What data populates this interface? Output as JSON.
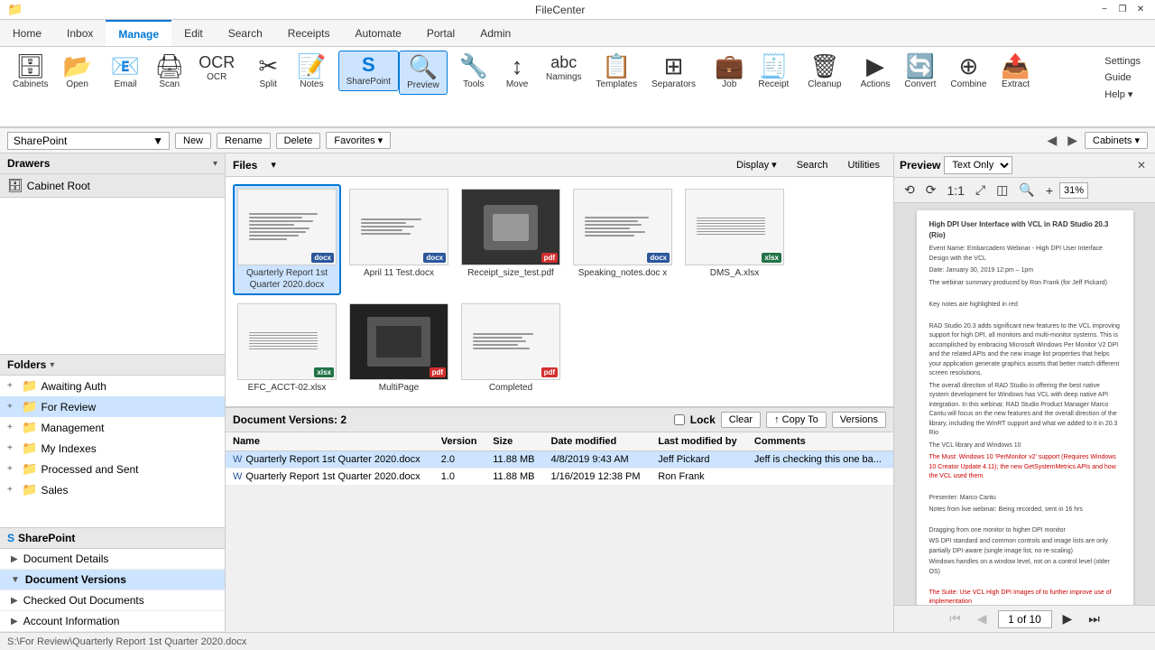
{
  "titlebar": {
    "title": "FileCenter",
    "minimize": "−",
    "restore": "❐",
    "close": "✕",
    "icon": "📁"
  },
  "ribbonTabs": [
    {
      "label": "Home",
      "active": false
    },
    {
      "label": "Inbox",
      "active": false
    },
    {
      "label": "Manage",
      "active": true
    },
    {
      "label": "Edit",
      "active": false
    },
    {
      "label": "Search",
      "active": false
    },
    {
      "label": "Receipts",
      "active": false
    },
    {
      "label": "Automate",
      "active": false
    },
    {
      "label": "Portal",
      "active": false
    },
    {
      "label": "Admin",
      "active": false
    }
  ],
  "ribbon": {
    "buttons": [
      {
        "id": "cabinets",
        "icon": "🗄",
        "label": "Cabinets"
      },
      {
        "id": "open",
        "icon": "📂",
        "label": "Open"
      },
      {
        "id": "email",
        "icon": "📧",
        "label": "Email"
      },
      {
        "id": "scan",
        "icon": "🖨",
        "label": "Scan"
      },
      {
        "id": "ocr",
        "icon": "📄",
        "label": "OCR"
      },
      {
        "id": "split",
        "icon": "✂",
        "label": "Split"
      },
      {
        "id": "notes",
        "icon": "📝",
        "label": "Notes"
      },
      {
        "id": "sharepoint",
        "icon": "S",
        "label": "SharePoint",
        "active": true
      },
      {
        "id": "preview",
        "icon": "🔍",
        "label": "Preview",
        "active": true
      },
      {
        "id": "tools",
        "icon": "🔧",
        "label": "Tools"
      },
      {
        "id": "move",
        "icon": "↕",
        "label": "Move"
      },
      {
        "id": "namings",
        "icon": "🏷",
        "label": "Namings"
      },
      {
        "id": "templates",
        "icon": "📋",
        "label": "Templates"
      },
      {
        "id": "separators",
        "icon": "⊞",
        "label": "Separators"
      },
      {
        "id": "job",
        "icon": "💼",
        "label": "Job"
      },
      {
        "id": "receipt",
        "icon": "🧾",
        "label": "Receipt"
      },
      {
        "id": "cleanup",
        "icon": "🗑",
        "label": "Cleanup"
      },
      {
        "id": "actions",
        "icon": "▶",
        "label": "Actions"
      },
      {
        "id": "convert",
        "icon": "🔄",
        "label": "Convert"
      },
      {
        "id": "combine",
        "icon": "⊕",
        "label": "Combine"
      },
      {
        "id": "extract",
        "icon": "📤",
        "label": "Extract"
      }
    ],
    "sideButtons": [
      {
        "label": "Settings"
      },
      {
        "label": "Guide"
      },
      {
        "label": "Help ▾"
      }
    ]
  },
  "addressBar": {
    "current": "SharePoint",
    "actions": [
      "New",
      "Rename",
      "Delete",
      "Favorites ▾"
    ],
    "navPrev": "◀",
    "navNext": "▶",
    "comboArrow": "▼",
    "cabinetsBtn": "Cabinets ▾"
  },
  "leftPanel": {
    "drawersLabel": "Drawers",
    "drawersExpand": "▾",
    "drawerInput": "",
    "cabinetRoot": "Cabinet Root",
    "foldersLabel": "Folders",
    "foldersExpand": "▾",
    "folders": [
      {
        "name": "Awaiting Auth",
        "expanded": false,
        "level": 1
      },
      {
        "name": "For Review",
        "expanded": false,
        "level": 1,
        "selected": true
      },
      {
        "name": "Management",
        "expanded": false,
        "level": 1
      },
      {
        "name": "My Indexes",
        "expanded": false,
        "level": 1
      },
      {
        "name": "Processed and Sent",
        "expanded": false,
        "level": 1
      },
      {
        "name": "Sales",
        "expanded": false,
        "level": 1
      }
    ]
  },
  "filesArea": {
    "label": "Files",
    "dropdownArrow": "▾",
    "toolbarButtons": [
      "Display ▾",
      "Search",
      "Utilities"
    ],
    "files": [
      {
        "name": "Quarterly Report 1st Quarter 2020.docx",
        "type": "docx",
        "selected": true,
        "hasLines": 8
      },
      {
        "name": "April 11 Test.docx",
        "type": "docx",
        "selected": false,
        "hasLines": 5
      },
      {
        "name": "Receipt_size_test.pdf",
        "type": "pdf",
        "selected": false,
        "hasLines": 4
      },
      {
        "name": "Speaking_notes.doc x",
        "type": "docx",
        "selected": false,
        "hasLines": 6
      },
      {
        "name": "DMS_A.xlsx",
        "type": "xlsx",
        "selected": false,
        "hasLines": 7
      },
      {
        "name": "EFC_ACCT-02.xlsx",
        "type": "xlsx",
        "selected": false,
        "hasLines": 7
      },
      {
        "name": "MultiPage",
        "type": "pdf",
        "selected": false,
        "hasLines": 3
      },
      {
        "name": "Completed",
        "type": "pdf",
        "selected": false,
        "hasLines": 5
      }
    ]
  },
  "bottomPanel": {
    "title": "Document Versions: 2",
    "lockLabel": "Lock",
    "clearLabel": "Clear",
    "copyToLabel": "↑ Copy To",
    "versionsLabel": "Versions",
    "columns": [
      "Name",
      "Version",
      "Size",
      "Date modified",
      "Last modified by",
      "Comments"
    ],
    "rows": [
      {
        "name": "Quarterly Report 1st Quarter 2020.docx",
        "version": "2.0",
        "size": "11.88 MB",
        "dateModified": "4/8/2019 9:43 AM",
        "lastModifiedBy": "Jeff Pickard",
        "comments": "Jeff is checking this one ba..."
      },
      {
        "name": "Quarterly Report 1st Quarter 2020.docx",
        "version": "1.0",
        "size": "11.88 MB",
        "dateModified": "1/16/2019 12:38 PM",
        "lastModifiedBy": "Ron Frank",
        "comments": ""
      }
    ]
  },
  "sharepointPanel": {
    "title": "SharePoint",
    "items": [
      {
        "label": "Document Details"
      },
      {
        "label": "Document Versions",
        "active": true
      },
      {
        "label": "Checked Out Documents"
      },
      {
        "label": "Account Information"
      }
    ]
  },
  "previewPanel": {
    "label": "Preview",
    "textOnlyLabel": "Text Only",
    "closeLabel": "×",
    "navButtons": [
      "⟲",
      "⟳",
      "1:1",
      "⤢",
      "◫",
      "🔍−",
      "31%"
    ],
    "pageNum": "1 of 10",
    "navFirst": "⏮",
    "navPrev": "◀",
    "navNext": "▶",
    "navLast": "⏭",
    "docContent": {
      "title": "High DPI User Interface with VCL in RAD Studio 20.3 (Rio)",
      "fields": [
        "Event Name: Embarcadero Webinar - High DPI User Interface Design with the VCL",
        "Date: January 30, 2019 12:pm – 1pm",
        "The webinar summary produced by Ron Frank (for Jeff Pickard)"
      ],
      "keyNotes": "Key notes are highlighted in red",
      "body": [
        "RAD Studio 20.3 adds significant new features to the VCL improving support for high DPI, all monitors and multi-monitor systems. This is accomplished by embracing Microsoft Windows Per Monitor V2 DPI and the related APIs and the new image list properties that helps your application generate graphics assets that better match different screen resolutions.",
        "The overall direction of RAD Studio in offering the best native system development for Windows has VCL with deep native API integration. In this webinar, RAD Studio Product Manager Marco Cantu will focus on the new features and the overall direction of the library, including the WinRT support and what we added to it in 20.3 Rio",
        "The VCL library and Windows 10",
        "The Must: Windows 10 'PerMonitor v2' support (Requires Windows 10 Creator Update 4.11); the new GetSystemMetrics APIs and how the VCL used them"
      ],
      "redText": "The Must: Windows 10 'PerMonitor v2' support (Requires Windows 10 Creator Update 4.11); the new GetSystemMetrics APIs and how the VCL used them"
    }
  },
  "statusBar": {
    "path": "S:\\For Review\\Quarterly Report 1st Quarter 2020.docx"
  }
}
